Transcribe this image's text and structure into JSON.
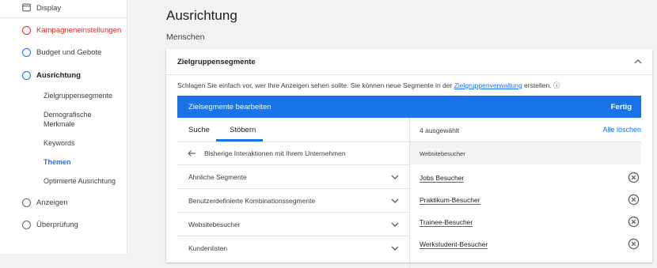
{
  "sidebar": {
    "items": [
      {
        "label": "Display"
      },
      {
        "label": "Kampagneneinstellungen"
      },
      {
        "label": "Budget und Gebote"
      },
      {
        "label": "Ausrichtung"
      },
      {
        "label": "Anzeigen"
      },
      {
        "label": "Überprüfung"
      }
    ],
    "sub_items": [
      {
        "label": "Zielgruppensegmente"
      },
      {
        "label": "Demografische Merkmale"
      },
      {
        "label": "Keywords"
      },
      {
        "label": "Themen"
      },
      {
        "label": "Optimierte Ausrichtung"
      }
    ]
  },
  "main": {
    "title": "Ausrichtung",
    "subtitle": "Menschen",
    "card": {
      "title": "Zielgruppensegmente",
      "hint_prefix": "Schlagen Sie einfach vor, wer Ihre Anzeigen sehen sollte.  Sie können neue Segmente in der ",
      "hint_link": "Zielgruppenverwaltung",
      "hint_suffix": " erstellen. ⓘ",
      "editor": {
        "title": "Zielsegmente bearbeiten",
        "done_label": "Fertig",
        "tabs": [
          {
            "label": "Suche"
          },
          {
            "label": "Stöbern"
          }
        ],
        "active_tab": "Stöbern",
        "back_label": "Bisherige Interaktionen mit Ihrem Unternehmen",
        "categories": [
          {
            "label": "Ähnliche Segmente"
          },
          {
            "label": "Benutzerdefinierte Kombinationssegmente"
          },
          {
            "label": "Websitebesucher"
          },
          {
            "label": "Kundenlisten"
          }
        ],
        "selected_count": "4 ausgewählt",
        "clear_all_label": "Alle löschen",
        "group_label": "Websitebesucher",
        "selected": [
          {
            "label": "Jobs Besucher"
          },
          {
            "label": "Praktikum-Besucher"
          },
          {
            "label": "Trainee-Besucher"
          },
          {
            "label": "Werkstudent-Besucher"
          }
        ]
      }
    }
  },
  "colors": {
    "accent": "#1a73e8",
    "alert": "#d93025"
  }
}
